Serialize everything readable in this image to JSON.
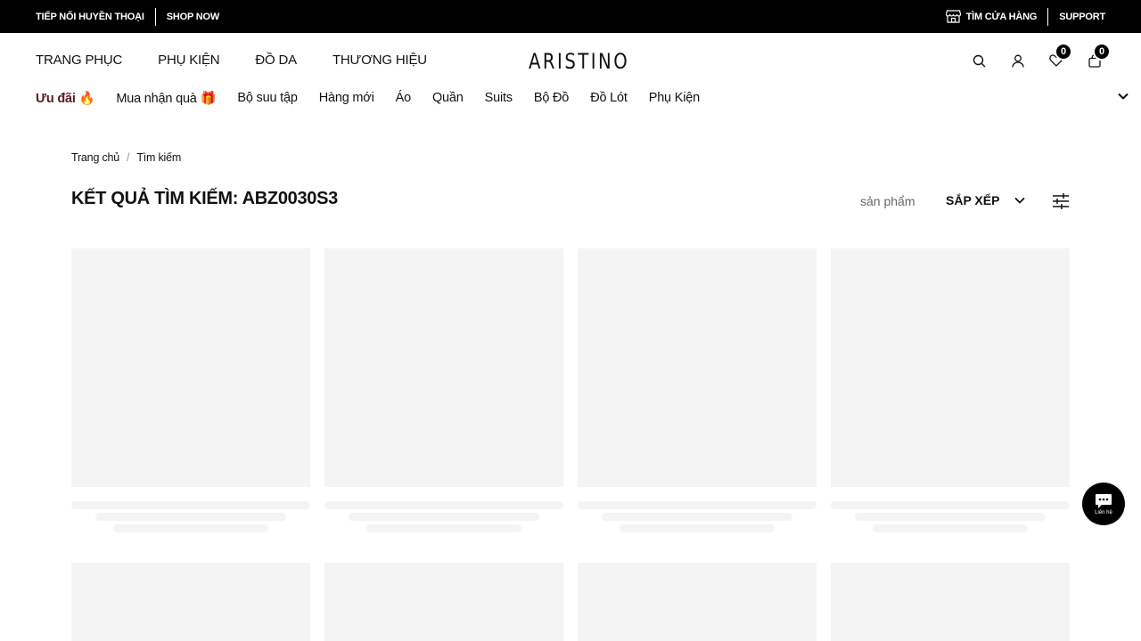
{
  "topbar": {
    "promo_text": "TIẾP NỐI HUYỀN THOẠI",
    "shop_now": "SHOP NOW",
    "find_store": "TÌM CỬA HÀNG",
    "support": "SUPPORT"
  },
  "header": {
    "logo": "ARISTINO",
    "nav": [
      "TRANG PHỤC",
      "PHỤ KIỆN",
      "ĐỒ DA",
      "THƯƠNG HIỆU"
    ],
    "wishlist_count": "0",
    "cart_count": "0"
  },
  "categories": {
    "promo": "Ưu đãi 🔥",
    "gift": "Mua nhận quà 🎁",
    "items": [
      "Bộ suu tập",
      "Hàng mới",
      "Áo",
      "Quần",
      "Suits",
      "Bộ Đồ",
      "Đồ Lót",
      "Phụ Kiện"
    ]
  },
  "breadcrumb": {
    "home": "Trang chủ",
    "current": "Tìm kiếm"
  },
  "results": {
    "title": "KẾT QUẢ TÌM KIẾM: ABZ0030S3",
    "count_label": "sản phẩm",
    "sort_label": "SẮP XẾP"
  },
  "chat": {
    "label": "Liên hệ"
  },
  "icons": {
    "store": "store-icon",
    "search": "search-icon",
    "account": "user-icon",
    "wishlist": "heart-icon",
    "cart": "bag-icon",
    "filter": "sliders-icon",
    "chat": "chat-icon"
  }
}
